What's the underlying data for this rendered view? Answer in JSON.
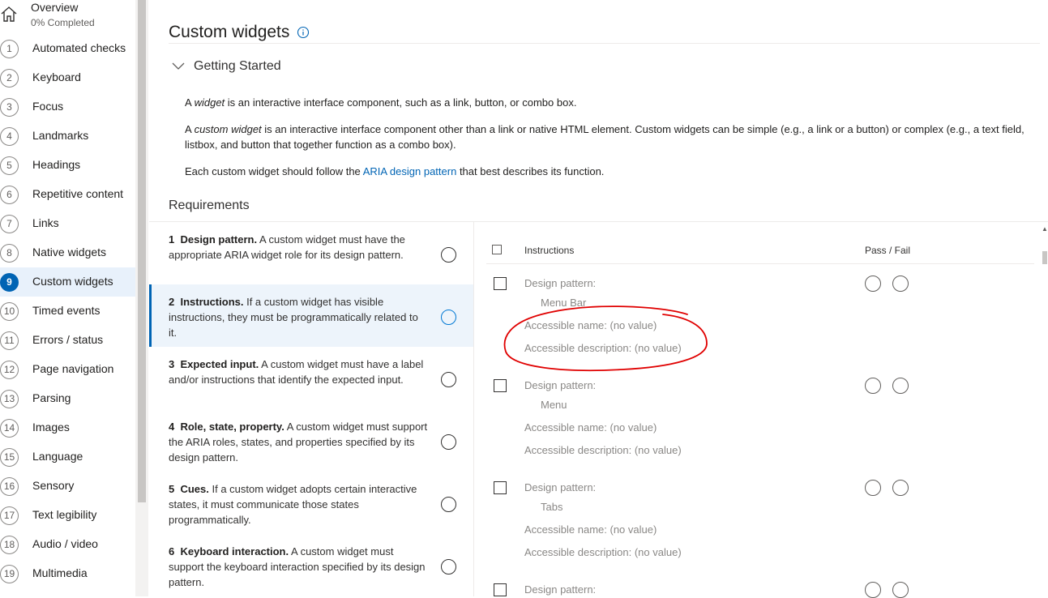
{
  "nav": {
    "overview": {
      "title": "Overview",
      "subtitle": "0% Completed"
    },
    "items": [
      {
        "num": "1",
        "label": "Automated checks"
      },
      {
        "num": "2",
        "label": "Keyboard"
      },
      {
        "num": "3",
        "label": "Focus"
      },
      {
        "num": "4",
        "label": "Landmarks"
      },
      {
        "num": "5",
        "label": "Headings"
      },
      {
        "num": "6",
        "label": "Repetitive content"
      },
      {
        "num": "7",
        "label": "Links"
      },
      {
        "num": "8",
        "label": "Native widgets"
      },
      {
        "num": "9",
        "label": "Custom widgets",
        "selected": true
      },
      {
        "num": "10",
        "label": "Timed events"
      },
      {
        "num": "11",
        "label": "Errors / status"
      },
      {
        "num": "12",
        "label": "Page navigation"
      },
      {
        "num": "13",
        "label": "Parsing"
      },
      {
        "num": "14",
        "label": "Images"
      },
      {
        "num": "15",
        "label": "Language"
      },
      {
        "num": "16",
        "label": "Sensory"
      },
      {
        "num": "17",
        "label": "Text legibility"
      },
      {
        "num": "18",
        "label": "Audio / video"
      },
      {
        "num": "19",
        "label": "Multimedia"
      }
    ]
  },
  "page": {
    "title": "Custom widgets",
    "getting_started": "Getting Started",
    "p1": {
      "a": "A ",
      "em": "widget",
      "b": " is an interactive interface component, such as a link, button, or combo box."
    },
    "p2": {
      "a": "A ",
      "em": "custom widget",
      "b": " is an interactive interface component other than a link or native HTML element. Custom widgets can be simple (e.g., a link or a button) or complex (e.g., a text field, listbox, and button that together function as a combo box)."
    },
    "p3": {
      "a": "Each custom widget should follow the ",
      "link": "ARIA design pattern",
      "b": " that best describes its function."
    },
    "requirements_title": "Requirements"
  },
  "requirements": [
    {
      "num": "1",
      "name": "Design pattern.",
      "desc": " A custom widget must have the appropriate ARIA widget role for its design pattern."
    },
    {
      "num": "2",
      "name": "Instructions.",
      "desc": " If a custom widget has visible instructions, they must be programmatically related to it.",
      "selected": true
    },
    {
      "num": "3",
      "name": "Expected input.",
      "desc": " A custom widget must have a label and/or instructions that identify the expected input."
    },
    {
      "num": "4",
      "name": "Role, state, property.",
      "desc": " A custom widget must support the ARIA roles, states, and properties specified by its design pattern."
    },
    {
      "num": "5",
      "name": "Cues.",
      "desc": " If a custom widget adopts certain interactive states, it must communicate those states programmatically."
    },
    {
      "num": "6",
      "name": "Keyboard interaction.",
      "desc": " A custom widget must support the keyboard interaction specified by its design pattern."
    }
  ],
  "table": {
    "col_instructions": "Instructions",
    "col_pass_fail": "Pass / Fail",
    "instances": [
      {
        "pattern_label": "Design pattern:",
        "pattern_value": "Menu Bar",
        "name": "Accessible name: (no value)",
        "description": "Accessible description: (no value)"
      },
      {
        "pattern_label": "Design pattern:",
        "pattern_value": "Menu",
        "name": "Accessible name: (no value)",
        "description": "Accessible description: (no value)"
      },
      {
        "pattern_label": "Design pattern:",
        "pattern_value": "Tabs",
        "name": "Accessible name: (no value)",
        "description": "Accessible description: (no value)"
      },
      {
        "pattern_label": "Design pattern:"
      }
    ]
  },
  "colors": {
    "accent": "#0064b4",
    "annotation": "#e00000",
    "muted_text": "#8a8886"
  }
}
